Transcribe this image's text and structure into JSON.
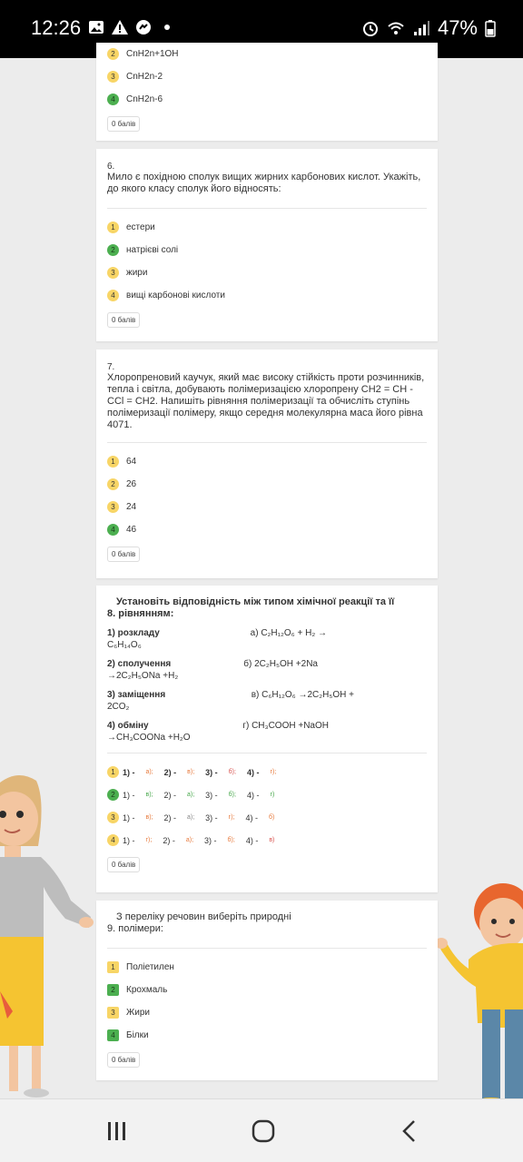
{
  "status": {
    "time": "12:26",
    "battery": "47%",
    "icons": [
      "image-icon",
      "alert-icon",
      "messenger-icon",
      "dot-icon",
      "alarm-icon",
      "wifi-icon",
      "signal-icon",
      "battery-icon"
    ]
  },
  "q5": {
    "options": [
      {
        "n": "2",
        "label": "CnH2n+1OH",
        "color": "yellow"
      },
      {
        "n": "3",
        "label": "CnH2n-2",
        "color": "yellow"
      },
      {
        "n": "4",
        "label": "CnH2n-6",
        "color": "green"
      }
    ],
    "score": "0 балів"
  },
  "q6": {
    "number": "6.",
    "text": "Мило є похідною сполук вищих жирних карбонових кислот. Укажіть, до якого класу сполук його відносять:",
    "options": [
      {
        "n": "1",
        "label": "естери",
        "color": "yellow"
      },
      {
        "n": "2",
        "label": "натрієві солі",
        "color": "green"
      },
      {
        "n": "3",
        "label": "жири",
        "color": "yellow"
      },
      {
        "n": "4",
        "label": "вищі карбонові кислоти",
        "color": "yellow"
      }
    ],
    "score": "0 балів"
  },
  "q7": {
    "number": "7.",
    "text": "Хлоропреновий каучук, який має високу стійкість проти розчинників, тепла і світла, добувають полімеризацією хлоропрену CH2 = CH - CCl = CH2. Напишіть рівняння полімеризації та обчисліть ступінь полімеризації полімеру, якщо середня молекулярна маса його рівна 4071.",
    "options": [
      {
        "n": "1",
        "label": "64",
        "color": "yellow"
      },
      {
        "n": "2",
        "label": "26",
        "color": "yellow"
      },
      {
        "n": "3",
        "label": "24",
        "color": "yellow"
      },
      {
        "n": "4",
        "label": "46",
        "color": "green"
      }
    ],
    "score": "0 балів"
  },
  "q8": {
    "title_line1": "Установіть відповідність між типом хімічної реакції та її",
    "number": "8.",
    "title_line2": "рівнянням:",
    "pairs": [
      {
        "left": "1)   розкладу",
        "right": "а) C₂H₁₂O₆ + H₂ →",
        "cont": "C₆H₁₄O₆"
      },
      {
        "left": "2)   сполучення",
        "right": "б) 2C₂H₅OH +2Na",
        "cont": "→2C₂H₅ONa +H₂"
      },
      {
        "left": "3)   заміщення",
        "right": "в) C₆H₁₂O₆ →2C₂H₅OH +",
        "cont": "2CO₂"
      },
      {
        "left": "4)   обміну",
        "right": "г) CH₃COOH +NaOH",
        "cont": "→CH₃COONa +H₂O"
      }
    ],
    "options": [
      {
        "n": "1",
        "color": "yellow",
        "bold": true,
        "parts": [
          [
            "1) -",
            ""
          ],
          [
            "а);",
            "or"
          ],
          [
            "2) -",
            ""
          ],
          [
            "в);",
            "or"
          ],
          [
            "3) -",
            ""
          ],
          [
            "б);",
            "rd"
          ],
          [
            "4) -",
            ""
          ],
          [
            "г);",
            "or"
          ]
        ]
      },
      {
        "n": "2",
        "color": "green",
        "bold": false,
        "parts": [
          [
            "1) -",
            ""
          ],
          [
            "в);",
            "gr"
          ],
          [
            "2) -",
            ""
          ],
          [
            "а);",
            "gr"
          ],
          [
            "3) -",
            ""
          ],
          [
            "б);",
            "gr"
          ],
          [
            "4) -",
            ""
          ],
          [
            "г)",
            "gr"
          ]
        ]
      },
      {
        "n": "3",
        "color": "yellow",
        "bold": false,
        "parts": [
          [
            "1) -",
            ""
          ],
          [
            "в);",
            "or"
          ],
          [
            "2) -",
            ""
          ],
          [
            "а);",
            "gy"
          ],
          [
            "3) -",
            ""
          ],
          [
            "г);",
            "or"
          ],
          [
            "4) -",
            ""
          ],
          [
            "б)",
            "or"
          ]
        ]
      },
      {
        "n": "4",
        "color": "yellow",
        "bold": false,
        "parts": [
          [
            "1) -",
            ""
          ],
          [
            "г);",
            "or"
          ],
          [
            "2) -",
            ""
          ],
          [
            "а);",
            "or"
          ],
          [
            "3) -",
            ""
          ],
          [
            "б);",
            "or"
          ],
          [
            "4) -",
            ""
          ],
          [
            "в)",
            "rd"
          ]
        ]
      }
    ],
    "score": "0 балів"
  },
  "q9": {
    "title_line1": "З переліку речовин виберіть природні",
    "number": "9.",
    "title_line2": "полімери:",
    "options": [
      {
        "n": "1",
        "label": "Поліетилен",
        "color": "yellow"
      },
      {
        "n": "2",
        "label": "Крохмаль",
        "color": "green"
      },
      {
        "n": "3",
        "label": "Жири",
        "color": "yellow"
      },
      {
        "n": "4",
        "label": "Білки",
        "color": "green"
      }
    ],
    "score": "0 балів"
  }
}
